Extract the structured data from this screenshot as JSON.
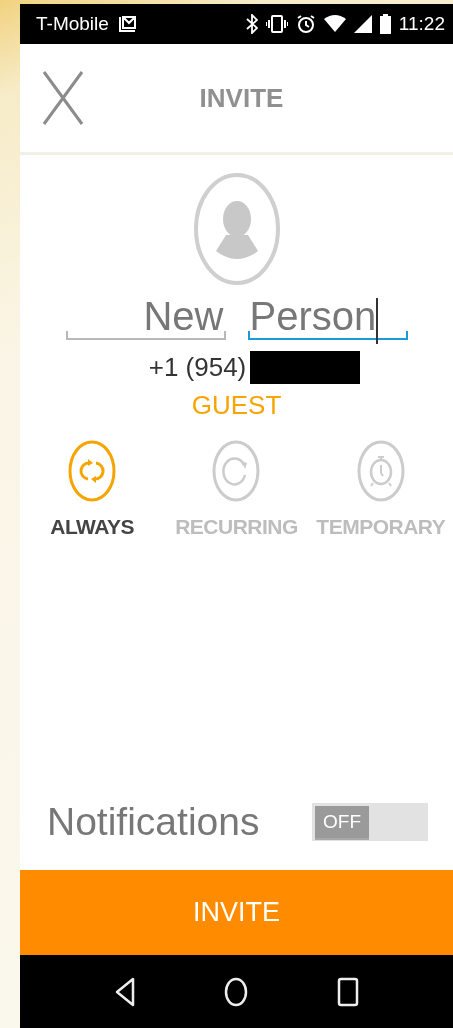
{
  "status_bar": {
    "carrier": "T-Mobile",
    "time": "11:22"
  },
  "header": {
    "title": "INVITE"
  },
  "name_fields": [
    {
      "value": "New",
      "focused": false
    },
    {
      "value": "Person",
      "focused": true
    }
  ],
  "phone": "+1 (954)",
  "role": "GUEST",
  "access_modes": [
    {
      "kind": "always",
      "label": "ALWAYS",
      "selected": true
    },
    {
      "kind": "recurring",
      "label": "RECURRING",
      "selected": false
    },
    {
      "kind": "temporary",
      "label": "TEMPORARY",
      "selected": false
    }
  ],
  "notifications": {
    "label": "Notifications",
    "on": false,
    "state_label": "OFF"
  },
  "invite_button": "INVITE"
}
